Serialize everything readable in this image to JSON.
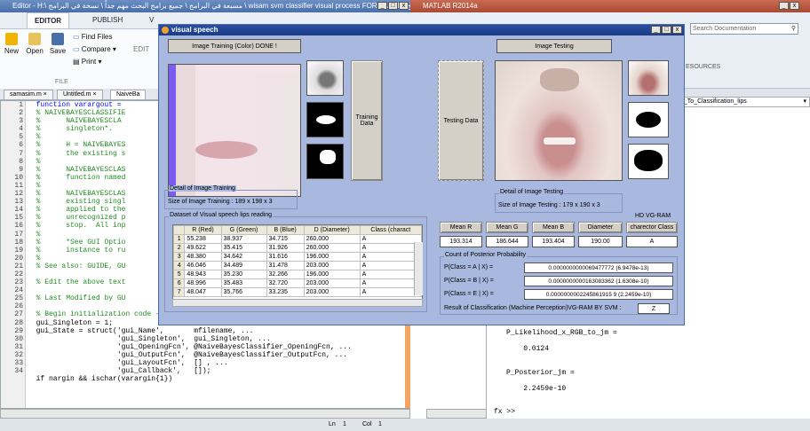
{
  "editor": {
    "title": "Editor - H:\\ مسبعة في البرامج \\ جميع برامج البحث مهم جداً \\ نسخة في البرامج \\ wisam svm classifier visual process FOR PAPER\\ البرامج",
    "tabs": [
      "EDITOR",
      "PUBLISH",
      "V"
    ],
    "buttons": {
      "new": "New",
      "open": "Open",
      "save": "Save",
      "find_files": "Find Files",
      "compare": "Compare",
      "print": "Print",
      "edit": "EDIT"
    },
    "section_label": "FILE",
    "file_tabs": [
      "samasim.m",
      "Untitled.m",
      "NaiveBa"
    ],
    "line_numbers": [
      "1",
      "2",
      "3",
      "4",
      "5",
      "6",
      "7",
      "8",
      "9",
      "10",
      "11",
      "12",
      "13",
      "14",
      "15",
      "16",
      "17",
      "18",
      "19",
      "20",
      "21",
      "22",
      "23",
      "24",
      "25",
      "26",
      "27",
      "28",
      "29",
      "30",
      "31",
      "32",
      "33",
      "34"
    ],
    "code_lines": [
      "  function varargout = ",
      "  % NAIVEBAYESCLASSIFIE",
      "  %      NAIVEBAYESCLA",
      "  %      singleton*.",
      "  %",
      "  %      H = NAIVEBAYES",
      "  %      the existing s",
      "  %",
      "  %      NAIVEBAYESCLAS",
      "  %      function named",
      "  %",
      "  %      NAIVEBAYESCLAS",
      "  %      existing singl",
      "  %      applied to the",
      "  %      unrecognized p",
      "  %      stop.  All inp",
      "  %",
      "  %      *See GUI Optio",
      "  %      instance to ru",
      "  %",
      "  % See also: GUIDE, GU",
      "",
      "  % Edit the above text",
      "",
      "  % Last Modified by GU",
      "",
      "  % Begin initialization code - DO NOT EDIT",
      "  gui_Singleton = 1;",
      "  gui_State = struct('gui_Name',       mfilename, ...",
      "                     'gui_Singleton',  gui_Singleton, ...",
      "                     'gui_OpeningFcn', @NaiveBayesClassifier_OpeningFcn, ...",
      "                     'gui_OutputFcn',  @NaiveBayesClassifier_OutputFcn, ...",
      "                     'gui_LayoutFcn',  [] , ...",
      "                     'gui_Callback',   []);"
    ],
    "last_line": "  if nargin && ischar(varargin{1})",
    "status_ln": "Ln",
    "status_ln_val": "1",
    "status_col": "Col",
    "status_col_val": "1"
  },
  "matlab": {
    "title": "MATLAB R2014a",
    "search_placeholder": "Search Documentation",
    "resources_label": "ESOURCES",
    "path_value": "e_To_Classification_lips",
    "cmd_lines": [
      "P_Likelihood_x_RGB_to_jm =",
      "",
      "    0.0124",
      "",
      "",
      "P_Posterior_jm =",
      "",
      "    2.2459e-10",
      ""
    ],
    "prompt": "fx >>"
  },
  "visual_speech": {
    "title": "visual speech",
    "left_status": "Image Training (Color) DONE !",
    "right_status": "Image Testing",
    "training_button": "Training Data",
    "testing_button": "Testing Data",
    "detail_training_title": "Detail of Image Training",
    "detail_training_text": "Size of Image Training :  189 x 198 x 3",
    "detail_testing_title": "Detail of Image Testing",
    "detail_testing_text": "Size of Image Testing :  179 x 190 x 3",
    "dataset_title": "Dataset of  Visual speech lips reading",
    "table_headers": [
      "",
      "R (Red)",
      "G (Green)",
      "B (Blue)",
      "D (Diameter)",
      "Class (charact"
    ],
    "table_rows": [
      [
        "1",
        "55.238",
        "38.937",
        "34.715",
        "260.000",
        "A"
      ],
      [
        "2",
        "49.622",
        "35.415",
        "31.926",
        "260.000",
        "A"
      ],
      [
        "3",
        "48.380",
        "34.642",
        "31.616",
        "196.000",
        "A"
      ],
      [
        "4",
        "46.046",
        "34.489",
        "31.478",
        "203.000",
        "A"
      ],
      [
        "5",
        "48.943",
        "35.230",
        "32.266",
        "196.000",
        "A"
      ],
      [
        "6",
        "48.996",
        "35.483",
        "32.720",
        "203.000",
        "A"
      ],
      [
        "7",
        "48.047",
        "35.766",
        "33.235",
        "203.000",
        "A"
      ]
    ],
    "means": {
      "headers": [
        "Mean R",
        "Mean G",
        "Mean B",
        "Diameter",
        "charector Class"
      ],
      "hd_label": "HD VG-RAM",
      "values": [
        "193.314",
        "186.644",
        "193.404",
        "190.00",
        "A"
      ]
    },
    "posterior": {
      "title": "Count of  Posterior Probability",
      "rows": [
        {
          "label": "P(Class = A | X) =",
          "value": "0.0000000000069477772  (6.9478e-13)"
        },
        {
          "label": "P(Class = B | X) =",
          "value": "0.0000000000163083362  (1.6308e-10)"
        },
        {
          "label": "P(Class = E | X) =",
          "value": "0.0000000002245861915 9  (2.2459e-10)"
        }
      ],
      "result_label": "Result of Classification (Machine Perception)VG-RAM BY SVM :",
      "result_value": "Z"
    }
  }
}
